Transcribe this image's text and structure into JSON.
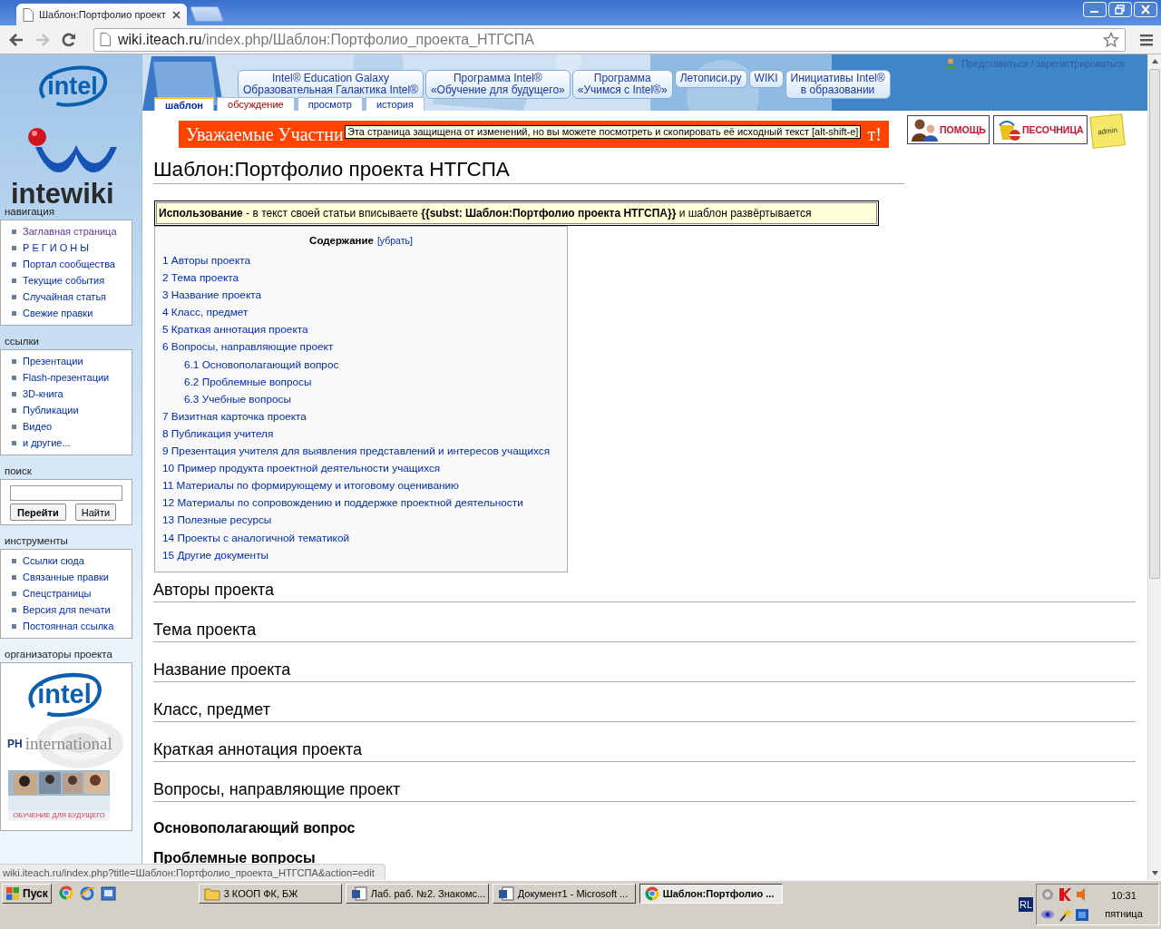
{
  "browser": {
    "tab_title": "Шаблон:Портфолио проект",
    "url_host": "wiki.iteach.ru",
    "url_path": "/index.php/Шаблон:Портфолио_проекта_НТГСПА"
  },
  "site_header": {
    "logo_text": "intel",
    "wiki_logo_text": "intewiki",
    "nav_buttons": [
      {
        "lines": [
          "Intel® Education Galaxy",
          "Образовательная Галактика Intel®"
        ]
      },
      {
        "lines": [
          "Программа Intel®",
          "«Обучение для будущего»"
        ]
      },
      {
        "lines": [
          "Программа",
          "«Учимся с Intel®»"
        ]
      },
      {
        "lines": [
          "Летописи.ру"
        ]
      },
      {
        "lines": [
          "WIKI"
        ]
      },
      {
        "lines": [
          "Инициативы Intel®",
          "в образовании"
        ]
      }
    ],
    "user_link": "Представиться / зарегистрироваться",
    "page_tabs": [
      {
        "label": "шаблон",
        "selected": true,
        "missing": false
      },
      {
        "label": "обсуждение",
        "selected": false,
        "missing": true
      },
      {
        "label": "просмотр",
        "selected": false,
        "missing": false
      },
      {
        "label": "история",
        "selected": false,
        "missing": false
      }
    ]
  },
  "banner": {
    "text_start": "Уважаемые Участни",
    "text_end": "т!"
  },
  "tooltip": "Эта страница защищена от изменений, но вы можете посмотреть и скопировать её исходный текст [alt-shift-e]",
  "side_buttons": [
    {
      "kind": "help",
      "label": "ПОМОЩЬ"
    },
    {
      "kind": "sandbox",
      "label": "ПЕСОЧНИЦА"
    },
    {
      "kind": "note",
      "label": "admin"
    }
  ],
  "sidebar": {
    "sections": [
      {
        "kind": "links",
        "title": "навигация",
        "items": [
          {
            "label": "Заглавная страница",
            "visited": true
          },
          {
            "label": "Р Е Г И О Н Ы",
            "visited": false
          },
          {
            "label": "Портал сообщества",
            "visited": false
          },
          {
            "label": "Текущие события",
            "visited": false
          },
          {
            "label": "Случайная статья",
            "visited": false
          },
          {
            "label": "Свежие правки",
            "visited": false
          }
        ]
      },
      {
        "kind": "links",
        "title": "ссылки",
        "items": [
          {
            "label": "Презентации",
            "visited": false
          },
          {
            "label": "Flash-презентации",
            "visited": false
          },
          {
            "label": "3D-книга",
            "visited": false
          },
          {
            "label": "Публикации",
            "visited": false
          },
          {
            "label": "Видео",
            "visited": false
          },
          {
            "label": "и другие...",
            "visited": false
          }
        ]
      },
      {
        "kind": "search",
        "title": "поиск",
        "buttons": [
          {
            "label": "Перейти",
            "default": true
          },
          {
            "label": "Найти",
            "default": false
          }
        ]
      },
      {
        "kind": "links",
        "title": "инструменты",
        "items": [
          {
            "label": "Ссылки сюда",
            "visited": false
          },
          {
            "label": "Связанные правки",
            "visited": false
          },
          {
            "label": "Спецстраницы",
            "visited": false
          },
          {
            "label": "Версия для печати",
            "visited": false
          },
          {
            "label": "Постоянная ссылка",
            "visited": false
          }
        ]
      },
      {
        "kind": "sponsors",
        "title": "организаторы проекта",
        "intel_text": "intel",
        "ph_text": "PH",
        "ph_name": "international",
        "picture_caption": "ОБУЧЕНИЕ ДЛЯ БУДУЩЕГО"
      }
    ]
  },
  "article": {
    "title": "Шаблон:Портфолио проекта НТГСПА",
    "usage": "**Использование** - в текст своей статьи вписываете **{{subst: Шаблон:Портфолио проекта НТГСПА}}** и шаблон развёртывается",
    "toc": {
      "title": "Содержание",
      "toggle": "[убрать]",
      "items": [
        {
          "label": "1 Авторы проекта"
        },
        {
          "label": "2 Тема проекта"
        },
        {
          "label": "3 Название проекта"
        },
        {
          "label": "4 Класс, предмет"
        },
        {
          "label": "5 Краткая аннотация проекта"
        },
        {
          "label": "6 Вопросы, направляющие проект",
          "children": [
            {
              "label": "6.1 Основополагающий вопрос"
            },
            {
              "label": "6.2 Проблемные вопросы"
            },
            {
              "label": "6.3 Учебные вопросы"
            }
          ]
        },
        {
          "label": "7 Визитная карточка проекта"
        },
        {
          "label": "8 Публикация учителя"
        },
        {
          "label": "9 Презентация учителя для выявления представлений и интересов учащихся"
        },
        {
          "label": "10 Пример продукта проектной деятельности учащихся"
        },
        {
          "label": "11 Материалы по формирующему и итоговому оцениванию"
        },
        {
          "label": "12 Материалы по сопровождению и поддержке проектной деятельности"
        },
        {
          "label": "13 Полезные ресурсы"
        },
        {
          "label": "14 Проекты с аналогичной тематикой"
        },
        {
          "label": "15 Другие документы"
        }
      ]
    },
    "headings": [
      {
        "kind": "h2",
        "text": "Авторы проекта"
      },
      {
        "kind": "h2",
        "text": "Тема проекта"
      },
      {
        "kind": "h2",
        "text": "Название проекта"
      },
      {
        "kind": "h2",
        "text": "Класс, предмет"
      },
      {
        "kind": "h2",
        "text": "Краткая аннотация проекта"
      },
      {
        "kind": "h2",
        "text": "Вопросы, направляющие проект"
      },
      {
        "kind": "h3",
        "text": "Основополагающий вопрос"
      },
      {
        "kind": "h3",
        "text": "Проблемные вопросы"
      }
    ]
  },
  "status_url": "wiki.iteach.ru/index.php?title=Шаблон:Портфолио_проекта_НТГСПА&action=edit",
  "taskbar": {
    "start": "Пуск",
    "quick_launch": [
      {
        "kind": "chrome"
      },
      {
        "kind": "ie"
      },
      {
        "kind": "desktop"
      }
    ],
    "tasks": [
      {
        "kind": "folder",
        "label": "3 КООП ФК, БЖ",
        "active": false
      },
      {
        "kind": "word",
        "label": "Лаб. раб. №2. Знакомс...",
        "active": false
      },
      {
        "kind": "word",
        "label": "Документ1 - Microsoft ...",
        "active": false
      },
      {
        "kind": "chrome",
        "label": "Шаблон:Портфолио ...",
        "active": true
      }
    ],
    "tray": {
      "lang": "RL",
      "time": "10:31",
      "day": "пятница"
    }
  }
}
